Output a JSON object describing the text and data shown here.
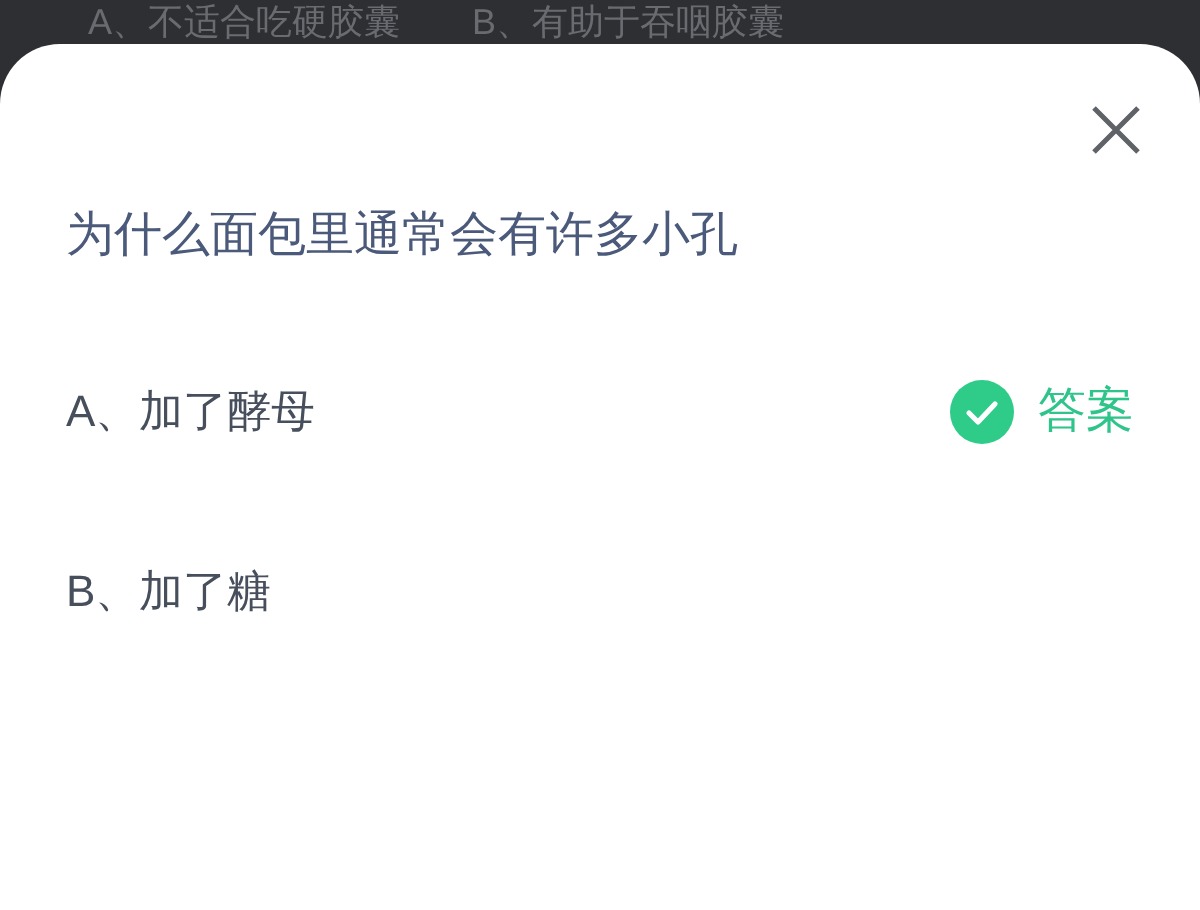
{
  "background_options": [
    "A、不适合吃硬胶囊",
    "B、有助于吞咽胶囊"
  ],
  "dialog": {
    "title": "为什么面包里通常会有许多小孔",
    "options": [
      {
        "label": "A、加了酵母",
        "correct": true,
        "badge": "答案"
      },
      {
        "label": "B、加了糖",
        "correct": false
      }
    ]
  }
}
